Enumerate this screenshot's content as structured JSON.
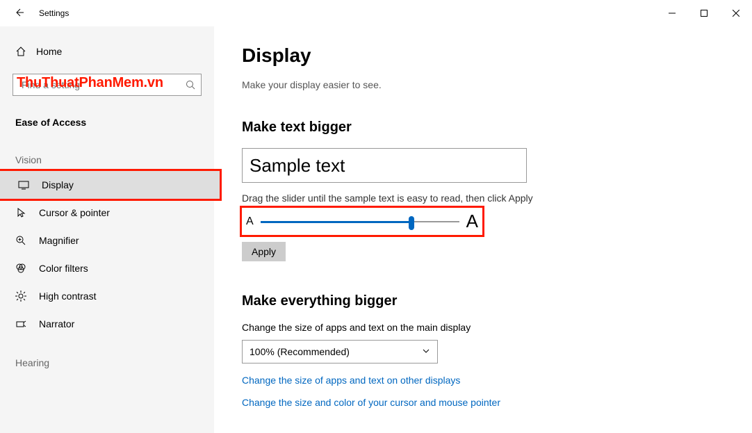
{
  "titlebar": {
    "title": "Settings"
  },
  "sidebar": {
    "home": "Home",
    "search_placeholder": "Find a setting",
    "section": "Ease of Access",
    "categories": {
      "vision": "Vision",
      "hearing": "Hearing"
    },
    "items": {
      "display": "Display",
      "cursor": "Cursor & pointer",
      "magnifier": "Magnifier",
      "colorfilters": "Color filters",
      "highcontrast": "High contrast",
      "narrator": "Narrator"
    }
  },
  "main": {
    "title": "Display",
    "subtitle": "Make your display easier to see.",
    "text_bigger": {
      "heading": "Make text bigger",
      "sample": "Sample text",
      "caption": "Drag the slider until the sample text is easy to read, then click Apply",
      "small_a": "A",
      "big_a": "A",
      "apply": "Apply"
    },
    "everything_bigger": {
      "heading": "Make everything bigger",
      "caption": "Change the size of apps and text on the main display",
      "selected": "100% (Recommended)",
      "link_other": "Change the size of apps and text on other displays",
      "link_cursor": "Change the size and color of your cursor and mouse pointer"
    }
  },
  "watermark": "ThuThuatPhanMem.vn"
}
